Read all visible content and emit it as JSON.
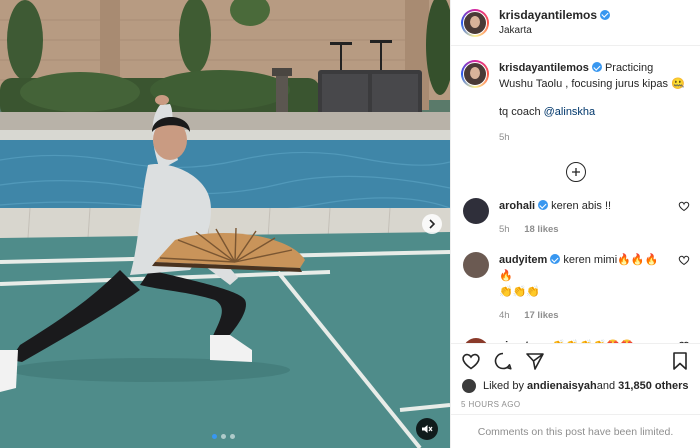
{
  "post": {
    "author": {
      "username": "krisdayantilemos",
      "verified": true,
      "location": "Jakarta"
    },
    "media": {
      "carousel_dots": 3,
      "active_dot": 1,
      "next_icon": "chevron-right-icon",
      "sound_icon": "speaker-muted-icon"
    },
    "caption": {
      "username": "krisdayantilemos",
      "text": "Practicing Wushu Taolu , focusing jurus kipas",
      "emoji": "🤐",
      "coach_prefix": "tq coach ",
      "coach_mention": "@alinskha",
      "time": "5h"
    },
    "load_more_icon": "plus-circle-icon",
    "comments": [
      {
        "username": "arohali",
        "verified": true,
        "text": "keren abis !!",
        "time": "5h",
        "likes": "18 likes",
        "avatar_color": "#2f2f3a"
      },
      {
        "username": "audyitem",
        "verified": true,
        "text": "keren mimi🔥🔥🔥🔥",
        "text2": "👏👏👏",
        "time": "4h",
        "likes": "17 likes",
        "avatar_color": "#6b5a52"
      },
      {
        "username": "airyntanu",
        "verified": false,
        "text": "👏👏👏👏🤩🤩",
        "time": "",
        "likes": "",
        "avatar_color": "#8a3a2a"
      }
    ],
    "actions": {
      "like_icon": "heart-icon",
      "comment_icon": "comment-icon",
      "share_icon": "paper-plane-icon",
      "save_icon": "bookmark-icon"
    },
    "liked_by": {
      "prefix": "Liked by ",
      "user": "andienaisyah",
      "middle": " and ",
      "others": "31,850 others"
    },
    "timestamp": "5 HOURS AGO",
    "comments_limited": "Comments on this post have been limited."
  },
  "colors": {
    "link_blue": "#00376b",
    "verified_blue": "#3897f0",
    "muted_gray": "#8e8e8e",
    "court_teal": "#4f8c8a",
    "pool_blue": "#3f86a8"
  }
}
